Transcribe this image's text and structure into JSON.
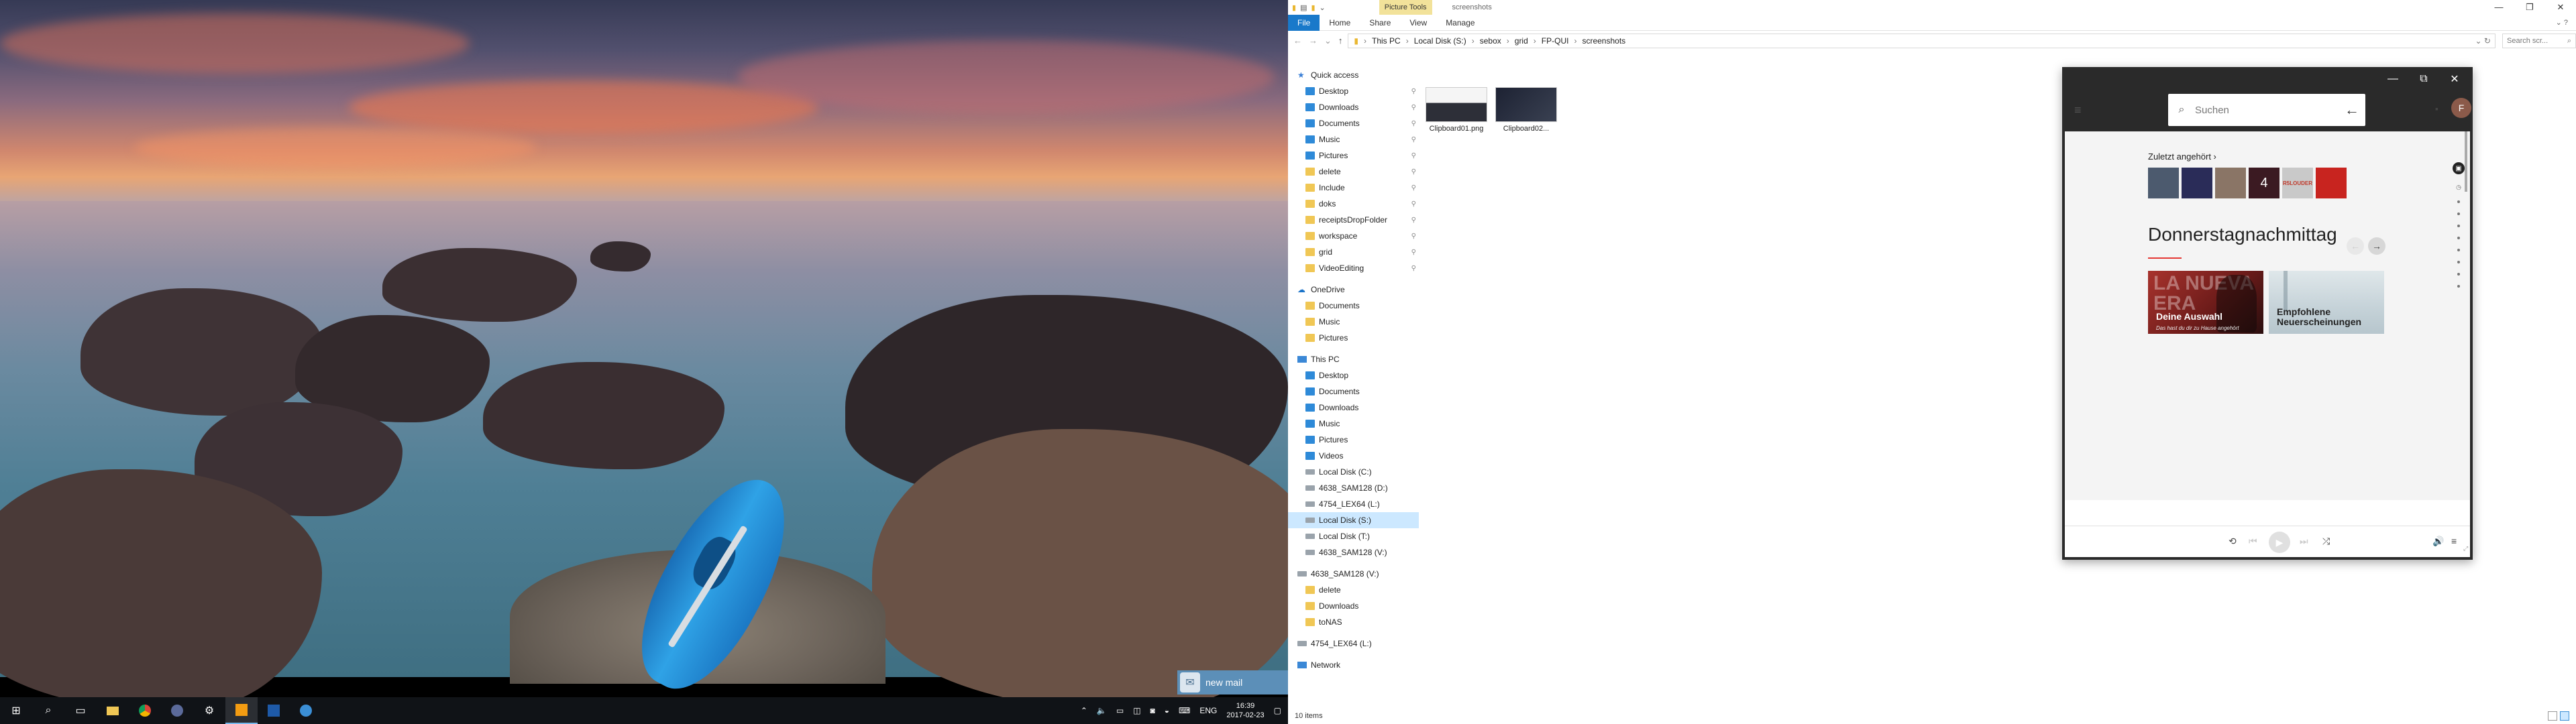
{
  "left_taskbar": {
    "language": "ENG",
    "time": "16:39",
    "date": "2017-02-23"
  },
  "toast": {
    "text": "new mail",
    "icon": "mail-client-icon"
  },
  "explorer": {
    "context_tab": "Picture Tools",
    "window_title": "screenshots",
    "ribbon_tabs": [
      "File",
      "Home",
      "Share",
      "View",
      "Manage"
    ],
    "path": [
      "This PC",
      "Local Disk (S:)",
      "sebox",
      "grid",
      "FP-QUI",
      "screenshots"
    ],
    "search_placeholder": "Search scr...",
    "nav": [
      {
        "label": "Quick access",
        "icon": "star-icon",
        "level": 0
      },
      {
        "label": "Desktop",
        "icon": "blue",
        "pinned": true,
        "level": 1
      },
      {
        "label": "Downloads",
        "icon": "blue",
        "pinned": true,
        "level": 1
      },
      {
        "label": "Documents",
        "icon": "blue",
        "pinned": true,
        "level": 1
      },
      {
        "label": "Music",
        "icon": "blue",
        "pinned": true,
        "level": 1
      },
      {
        "label": "Pictures",
        "icon": "blue",
        "pinned": true,
        "level": 1
      },
      {
        "label": "delete",
        "icon": "folder",
        "pinned": true,
        "level": 1
      },
      {
        "label": "Include",
        "icon": "folder",
        "pinned": true,
        "level": 1
      },
      {
        "label": "doks",
        "icon": "folder",
        "pinned": true,
        "level": 1
      },
      {
        "label": "receiptsDropFolder",
        "icon": "folder",
        "pinned": true,
        "level": 1
      },
      {
        "label": "workspace",
        "icon": "folder",
        "pinned": true,
        "level": 1
      },
      {
        "label": "grid",
        "icon": "folder",
        "pinned": true,
        "level": 1
      },
      {
        "label": "VideoEditing",
        "icon": "folder",
        "pinned": true,
        "level": 1
      },
      {
        "label": "",
        "icon": "",
        "level": -1
      },
      {
        "label": "OneDrive",
        "icon": "cloud-icon",
        "level": 0
      },
      {
        "label": "Documents",
        "icon": "folder",
        "level": 1
      },
      {
        "label": "Music",
        "icon": "folder",
        "level": 1
      },
      {
        "label": "Pictures",
        "icon": "folder",
        "level": 1
      },
      {
        "label": "",
        "icon": "",
        "level": -1
      },
      {
        "label": "This PC",
        "icon": "pc",
        "level": 0
      },
      {
        "label": "Desktop",
        "icon": "blue",
        "level": 1
      },
      {
        "label": "Documents",
        "icon": "blue",
        "level": 1
      },
      {
        "label": "Downloads",
        "icon": "blue",
        "level": 1
      },
      {
        "label": "Music",
        "icon": "blue",
        "level": 1
      },
      {
        "label": "Pictures",
        "icon": "blue",
        "level": 1
      },
      {
        "label": "Videos",
        "icon": "blue",
        "level": 1
      },
      {
        "label": "Local Disk (C:)",
        "icon": "drive",
        "level": 1
      },
      {
        "label": "4638_SAM128 (D:)",
        "icon": "drive",
        "level": 1
      },
      {
        "label": "4754_LEX64 (L:)",
        "icon": "drive",
        "level": 1
      },
      {
        "label": "Local Disk (S:)",
        "icon": "drive",
        "level": 1,
        "selected": true
      },
      {
        "label": "Local Disk (T:)",
        "icon": "drive",
        "level": 1
      },
      {
        "label": "4638_SAM128 (V:)",
        "icon": "drive",
        "level": 1
      },
      {
        "label": "",
        "icon": "",
        "level": -1
      },
      {
        "label": "4638_SAM128 (V:)",
        "icon": "drive",
        "level": 0
      },
      {
        "label": "delete",
        "icon": "folder",
        "level": 1
      },
      {
        "label": "Downloads",
        "icon": "folder",
        "level": 1
      },
      {
        "label": "toNAS",
        "icon": "folder",
        "level": 1
      },
      {
        "label": "",
        "icon": "",
        "level": -1
      },
      {
        "label": "4754_LEX64 (L:)",
        "icon": "drive",
        "level": 0
      },
      {
        "label": "",
        "icon": "",
        "level": -1
      },
      {
        "label": "Network",
        "icon": "pc",
        "level": 0
      }
    ],
    "files": [
      {
        "name": "Clipboard01.png"
      },
      {
        "name": "Clipboard02..."
      }
    ],
    "status": "10 items"
  },
  "player": {
    "search_placeholder": "Suchen",
    "avatar_letter": "F",
    "recent_title": "Zuletzt angehört ›",
    "recent_albums": [
      {
        "text": "",
        "color": "#4c5a6e"
      },
      {
        "text": "",
        "color": "#2a2c58"
      },
      {
        "text": "",
        "color": "#8a7566"
      },
      {
        "text": "4",
        "color": "#3b1a22"
      },
      {
        "text": "R5LOUDER",
        "color": "#c9c9c9"
      },
      {
        "text": "",
        "color": "#c8241f"
      }
    ],
    "section_title": "Donnerstagnachmittag",
    "cards": [
      {
        "watermark": "LA NUEVA ERA",
        "title": "Deine Auswahl",
        "subtitle": "Das hast du dir zu Hause angehört"
      },
      {
        "watermark": "",
        "title": "Empfohlene Neuerscheinungen",
        "subtitle": ""
      }
    ]
  }
}
